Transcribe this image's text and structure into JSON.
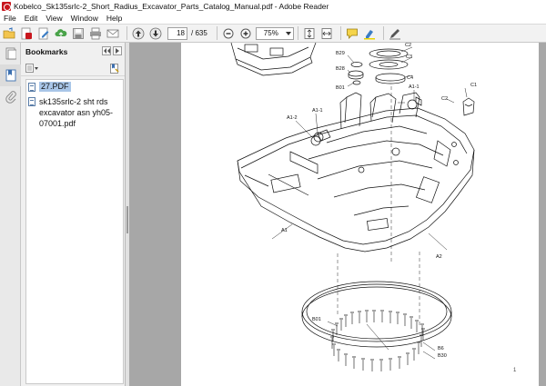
{
  "window": {
    "title": "Kobelco_Sk135srlc-2_Short_Radius_Excavator_Parts_Catalog_Manual.pdf - Adobe Reader"
  },
  "menu": [
    "File",
    "Edit",
    "View",
    "Window",
    "Help"
  ],
  "toolbar": {
    "current_page": "18",
    "page_total": "/ 635",
    "zoom": "75%"
  },
  "bookmarks": {
    "title": "Bookmarks",
    "items": [
      {
        "label": "27.PDF",
        "selected": true
      },
      {
        "label": "sk135srlc-2  sht rds excavator asn yh05-07001.pdf",
        "selected": false
      }
    ]
  },
  "drawing": {
    "labels": {
      "c2a": "C2",
      "c3": "C3",
      "c4": "C4",
      "c1": "C1",
      "c2b": "C2",
      "b29": "B29",
      "b28": "B28",
      "b01a": "B01",
      "a1_1a": "A1-1",
      "a1_2": "A1-2",
      "a1_1b": "A1-1",
      "a1": "A1",
      "a2": "A2",
      "b01b": "B01",
      "b6": "B6",
      "b30": "B30"
    },
    "page_mark": "1"
  },
  "colors": {
    "selection": "#a9c6e8",
    "canvas_gray": "#a7a7a7"
  }
}
